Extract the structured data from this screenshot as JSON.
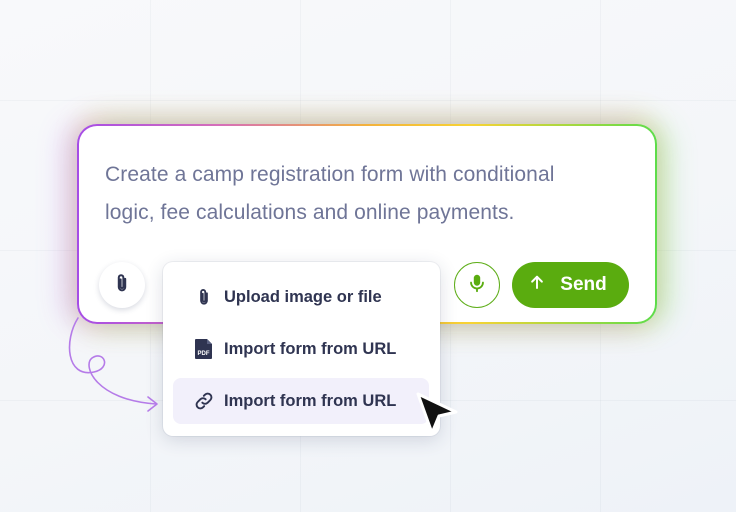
{
  "prompt": {
    "text_line1": "Create a camp registration form with conditional",
    "text_line2": "logic, fee calculations and online payments."
  },
  "buttons": {
    "attach_icon": "paperclip-icon",
    "mic_icon": "microphone-icon",
    "send_icon": "arrow-up-icon",
    "send_label": "Send"
  },
  "attach_menu": {
    "items": [
      {
        "icon": "paperclip-icon",
        "label": "Upload image or file"
      },
      {
        "icon": "pdf-file-icon",
        "label": "Import form from URL"
      },
      {
        "icon": "link-icon",
        "label": "Import form from URL"
      }
    ],
    "highlighted_index": 2
  },
  "colors": {
    "accent_green": "#5aac0f",
    "menu_text": "#2f3451",
    "prompt_text": "#6f7597",
    "highlight_bg": "#f2f0fb",
    "annotation_purple": "#b57be8"
  }
}
